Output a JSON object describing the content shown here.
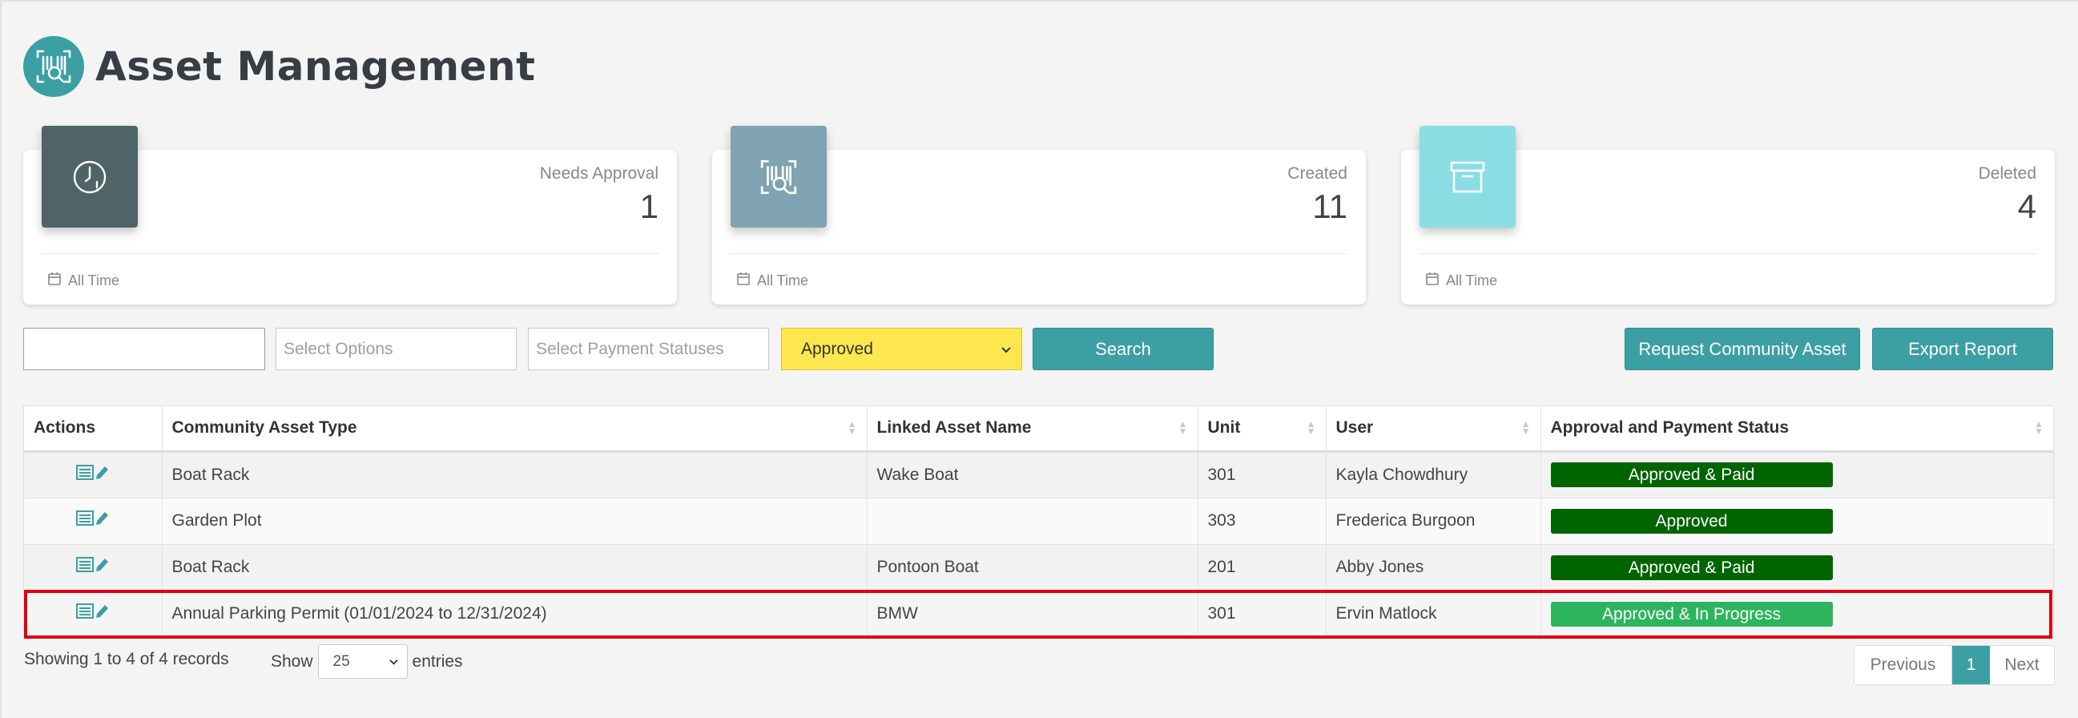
{
  "header": {
    "title": "Asset Management",
    "logo_icon": "asset-scan-icon"
  },
  "cards": [
    {
      "label": "Needs Approval",
      "value": "1",
      "footer": "All Time",
      "icon": "clock-icon",
      "color": "#4e6466"
    },
    {
      "label": "Created",
      "value": "11",
      "footer": "All Time",
      "icon": "asset-scan-icon",
      "color": "#7fa3b0"
    },
    {
      "label": "Deleted",
      "value": "4",
      "footer": "All Time",
      "icon": "archive-box-icon",
      "color": "#8bdde4"
    }
  ],
  "filters": {
    "search_value": "",
    "options_placeholder": "Select Options",
    "payment_placeholder": "Select Payment Statuses",
    "approval_selected": "Approved",
    "search_button": "Search",
    "request_button": "Request Community Asset",
    "export_button": "Export Report"
  },
  "table": {
    "columns": [
      "Actions",
      "Community Asset Type",
      "Linked Asset Name",
      "Unit",
      "User",
      "Approval and Payment Status"
    ],
    "rows": [
      {
        "type": "Boat Rack",
        "linked": "Wake Boat",
        "unit": "301",
        "user": "Kayla Chowdhury",
        "status": "Approved & Paid"
      },
      {
        "type": "Garden Plot",
        "linked": "",
        "unit": "303",
        "user": "Frederica Burgoon",
        "status": "Approved"
      },
      {
        "type": "Boat Rack",
        "linked": "Pontoon Boat",
        "unit": "201",
        "user": "Abby Jones",
        "status": "Approved & Paid"
      },
      {
        "type": "Annual Parking Permit (01/01/2024 to 12/31/2024)",
        "linked": "BMW",
        "unit": "301",
        "user": "Ervin Matlock",
        "status": "Approved & In Progress"
      }
    ]
  },
  "footer": {
    "showing": "Showing 1 to 4 of 4 records",
    "show_label": "Show",
    "entries_value": "25",
    "entries_label": "entries",
    "previous": "Previous",
    "current_page": "1",
    "next": "Next"
  },
  "colors": {
    "accent": "#3c9fa4",
    "approved_dark": "#006400",
    "in_progress": "#2db55d",
    "approved_filter": "#fde74f",
    "highlight": "#e00010"
  }
}
